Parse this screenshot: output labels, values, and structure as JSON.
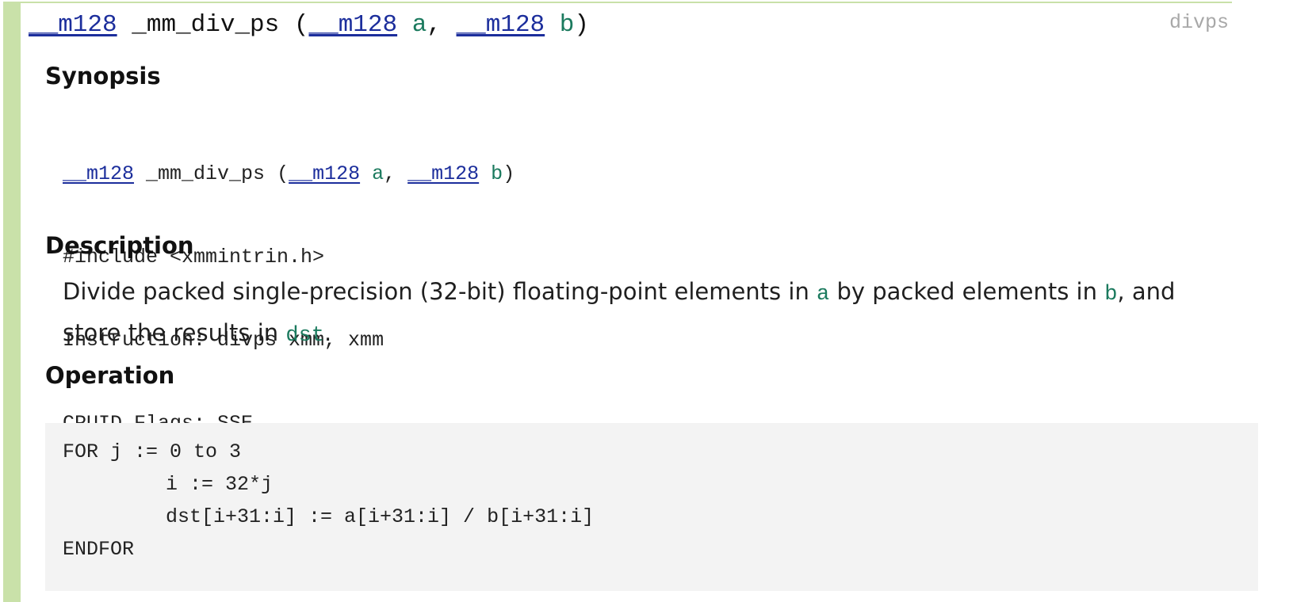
{
  "header": {
    "return_type": "__m128",
    "function_name": "_mm_div_ps",
    "open_paren": " (",
    "param1_type": "__m128",
    "param1_name": "a",
    "separator": ", ",
    "param2_type": "__m128",
    "param2_name": "b",
    "close_paren": ")",
    "instruction_tag": "divps"
  },
  "sections": {
    "synopsis_title": "Synopsis",
    "description_title": "Description",
    "operation_title": "Operation"
  },
  "synopsis": {
    "return_type": "__m128",
    "function_name": "_mm_div_ps",
    "open_paren": " (",
    "param1_type": "__m128",
    "param1_name": "a",
    "separator": ", ",
    "param2_type": "__m128",
    "param2_name": "b",
    "close_paren": ")",
    "include_line": "#include <xmmintrin.h>",
    "instruction_line": "Instruction: divps xmm, xmm",
    "cpuid_line": "CPUID Flags: SSE"
  },
  "description": {
    "part1": "Divide packed single-precision (32-bit) floating-point elements in ",
    "var_a": "a",
    "part2": " by packed elements in ",
    "var_b": "b",
    "part3": ", and store the results in ",
    "var_dst": "dst",
    "part4": "."
  },
  "operation": {
    "lines": [
      "FOR j := 0 to 3",
      "\ti := 32*j",
      "\tdst[i+31:i] := a[i+31:i] / b[i+31:i]",
      "ENDFOR"
    ]
  },
  "colors": {
    "accent_bar": "#c9e1a9",
    "type_color": "#1c2e9c",
    "param_color": "#1b7a5e",
    "operation_bg": "#f3f3f3"
  }
}
